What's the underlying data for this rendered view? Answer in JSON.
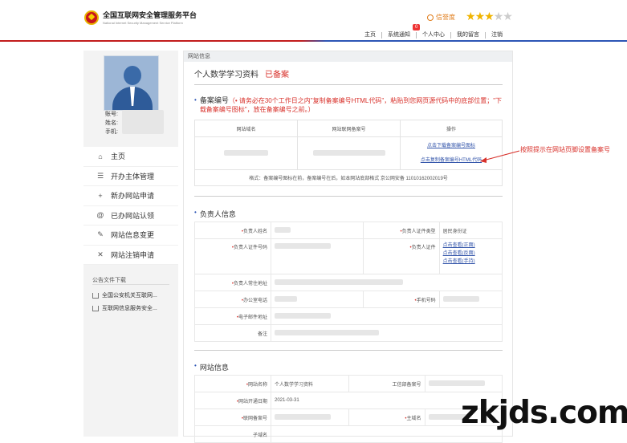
{
  "header": {
    "logo_cn": "全国互联网安全管理服务平台",
    "logo_en": "National Internet Security Management Service Platform",
    "credit_label": "信誉度",
    "rating_stars": 3,
    "rating_max": 5,
    "nav_badge": "0",
    "nav": [
      "主页",
      "系统通知",
      "个人中心",
      "我的留言",
      "注销"
    ]
  },
  "sidebar": {
    "profile": {
      "id_label": "账号:",
      "name_label": "姓名:",
      "phone_label": "手机:"
    },
    "menu": [
      {
        "icon": "home-icon",
        "glyph": "⌂",
        "label": "主页"
      },
      {
        "icon": "list-icon",
        "glyph": "☰",
        "label": "开办主体管理"
      },
      {
        "icon": "plus-icon",
        "glyph": "+",
        "label": "新办网站申请"
      },
      {
        "icon": "at-icon",
        "glyph": "@",
        "label": "已办网站认领"
      },
      {
        "icon": "edit-icon",
        "glyph": "✎",
        "label": "网站信息变更"
      },
      {
        "icon": "close-icon",
        "glyph": "✕",
        "label": "网站注销申请"
      }
    ],
    "notice_title": "公告文件下载",
    "notices": [
      "全国公安机关互联网...",
      "互联网信息服务安全..."
    ]
  },
  "main": {
    "section_header": "网站信息",
    "site_name": "个人数学学习资料",
    "site_status": "已备案",
    "record": {
      "title": "备案编号",
      "note": "（• 请务必在30个工作日之内\"复制备案编号HTML代码\"，粘贴到您网页源代码中的底部位置；\"下载备案编号图标\"，放在备案编号之前。）",
      "col_domain": "网站域名",
      "col_number": "网站联网备案号",
      "col_action": "操作",
      "link_download": "点击下载备案编号图标",
      "link_copy": "点击复制备案编号HTML代码",
      "format": "格式：备案编号图标在前，备案编号在后，如本网站底部格式 京公网安备 11010162002019号"
    },
    "owner": {
      "title": "负责人信息",
      "name_label": "负责人姓名",
      "idtype_label": "负责人证件类型",
      "idtype_value": "居民身份证",
      "idnum_label": "负责人证件号码",
      "cert_label": "负责人证件",
      "view_front": "点击查看(正面)",
      "view_back": "点击查看(反面)",
      "view_hand": "点击查看(手持)",
      "addr_label": "负责人常住地址",
      "phone_label": "办公室电话",
      "mobile_label": "手机号码",
      "email_label": "电子邮件地址",
      "remark_label": "备注"
    },
    "site": {
      "title": "网站信息",
      "name_label": "网站名称",
      "name_value": "个人数学学习资料",
      "icp_label": "工信部备案号",
      "date_label": "网站开通日期",
      "date_value": "2021-03-31",
      "netrec_label": "联网备案号",
      "domain_label": "主域名",
      "other_label": "子域名"
    }
  },
  "annotation": "按照提示在网站页脚设置备案号",
  "watermark": "zkjds.com",
  "colors": {
    "accent_red": "#d8312b",
    "link_blue": "#3355aa",
    "brand_blue": "#2c55b5"
  }
}
